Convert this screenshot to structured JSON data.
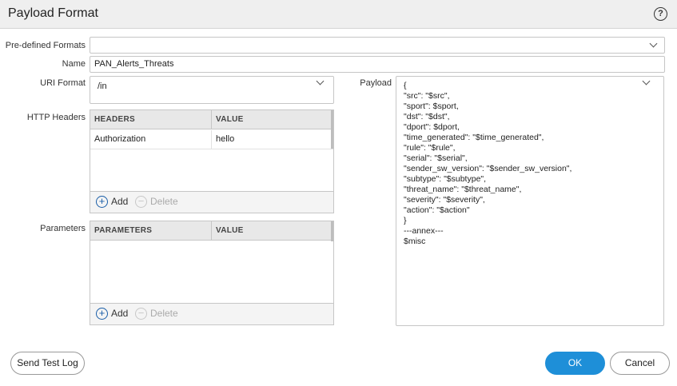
{
  "dialog": {
    "title": "Payload Format",
    "help_icon": "?"
  },
  "form": {
    "predefined_formats": {
      "label": "Pre-defined Formats",
      "value": ""
    },
    "name": {
      "label": "Name",
      "value": "PAN_Alerts_Threats"
    },
    "uri_format": {
      "label": "URI Format",
      "value": "/in"
    },
    "http_headers": {
      "label": "HTTP Headers",
      "columns": [
        "HEADERS",
        "VALUE"
      ],
      "rows": [
        {
          "header": "Authorization",
          "value": "hello"
        }
      ],
      "add_label": "Add",
      "delete_label": "Delete"
    },
    "parameters": {
      "label": "Parameters",
      "columns": [
        "PARAMETERS",
        "VALUE"
      ],
      "rows": [],
      "add_label": "Add",
      "delete_label": "Delete"
    },
    "payload": {
      "label": "Payload",
      "lines": [
        "{",
        "\"src\": \"$src\",",
        "\"sport\": $sport,",
        "\"dst\": \"$dst\",",
        "\"dport\": $dport,",
        "\"time_generated\": \"$time_generated\",",
        "\"rule\": \"$rule\",",
        "\"serial\": \"$serial\",",
        "\"sender_sw_version\": \"$sender_sw_version\",",
        "\"subtype\": \"$subtype\",",
        "\"threat_name\": \"$threat_name\",",
        "\"severity\": \"$severity\",",
        "\"action\": \"$action\"",
        "}",
        "---annex---",
        "$misc"
      ]
    }
  },
  "buttons": {
    "send_test_log": "Send Test Log",
    "ok": "OK",
    "cancel": "Cancel"
  },
  "colors": {
    "primary": "#1e8fd8",
    "add_icon": "#1a5ea8"
  }
}
